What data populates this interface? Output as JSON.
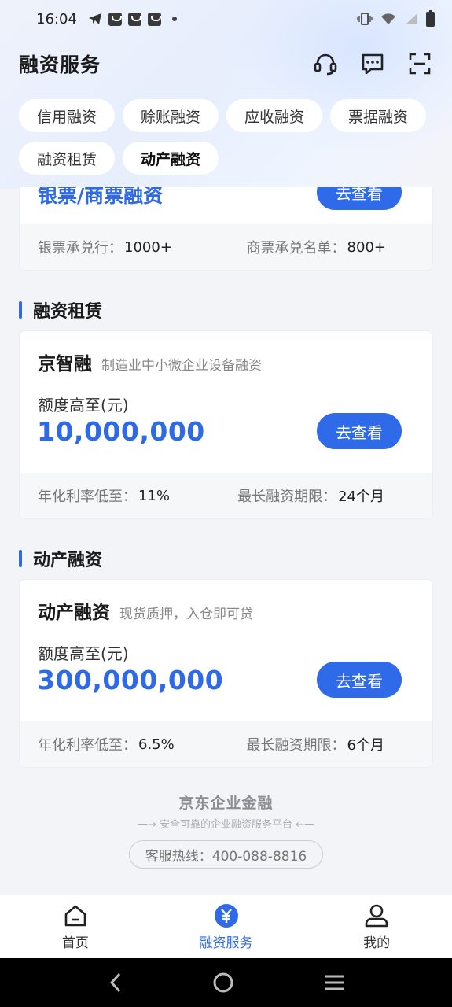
{
  "status_bar": {
    "time": "16:04"
  },
  "header": {
    "title": "融资服务"
  },
  "chips": {
    "row1": [
      "信用融资",
      "赊账融资",
      "应收融资",
      "票据融资"
    ],
    "row2": [
      "融资租赁",
      "动产融资"
    ],
    "active": "动产融资"
  },
  "partial_card": {
    "title_partial": "银票/商票融资",
    "button": "去查看",
    "left_label": "银票承兑行：",
    "left_value": "1000+",
    "right_label": "商票承兑名单：",
    "right_value": "800+"
  },
  "sections": [
    {
      "heading": "融资租赁",
      "card": {
        "title": "京智融",
        "subtitle": "制造业中小微企业设备融资",
        "amount_label": "额度高至(元)",
        "amount": "10,000,000",
        "button": "去查看",
        "left_label": "年化利率低至：",
        "left_value": "11%",
        "right_label": "最长融资期限：",
        "right_value": "24个月"
      }
    },
    {
      "heading": "动产融资",
      "card": {
        "title": "动产融资",
        "subtitle": "现货质押，入仓即可贷",
        "amount_label": "额度高至(元)",
        "amount": "300,000,000",
        "button": "去查看",
        "left_label": "年化利率低至：",
        "left_value": "6.5%",
        "right_label": "最长融资期限：",
        "right_value": "6个月"
      }
    }
  ],
  "footer": {
    "brand": "京东企业金融",
    "tagline": "—→ 安全可靠的企业融资服务平台 ←—",
    "hotline": "客服热线：400-088-8816"
  },
  "tabbar": {
    "items": [
      {
        "label": "首页",
        "icon": "home-icon"
      },
      {
        "label": "融资服务",
        "icon": "yuan-icon"
      },
      {
        "label": "我的",
        "icon": "user-icon"
      }
    ],
    "active": "融资服务"
  },
  "colors": {
    "accent": "#2f6ae8",
    "amount": "#2e6ae6"
  }
}
